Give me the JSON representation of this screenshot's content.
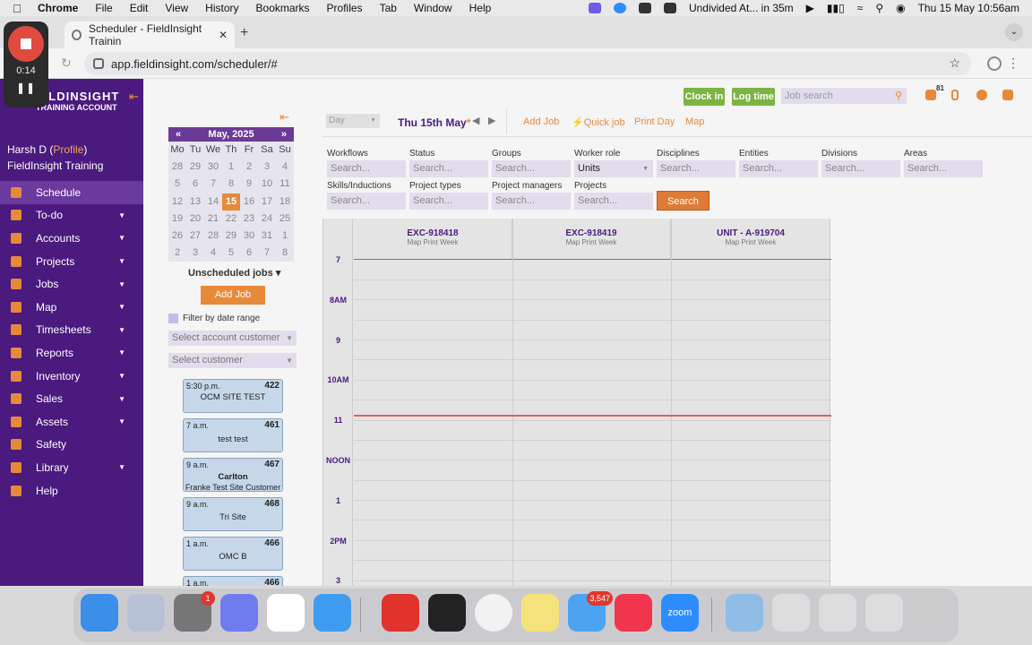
{
  "menubar": {
    "app": "Chrome",
    "items": [
      "File",
      "Edit",
      "View",
      "History",
      "Bookmarks",
      "Profiles",
      "Tab",
      "Window",
      "Help"
    ],
    "meeting": "Undivided At... in 35m",
    "datetime": "Thu 15 May  10:56am"
  },
  "browser": {
    "tab_title": "Scheduler - FieldInsight Trainin",
    "url": "app.fieldinsight.com/scheduler/#"
  },
  "recorder": {
    "time": "0:14"
  },
  "brand": {
    "name": "FIELDINSIGHT",
    "name_visible": "IELDINSIGHT",
    "account": "TRAINING ACCOUNT"
  },
  "user": {
    "name": "Harsh D",
    "profile_link": "Profile",
    "org": "FieldInsight Training"
  },
  "nav": [
    {
      "label": "Schedule",
      "arrow": false,
      "active": true
    },
    {
      "label": "To-do",
      "arrow": true
    },
    {
      "label": "Accounts",
      "arrow": true
    },
    {
      "label": "Projects",
      "arrow": true
    },
    {
      "label": "Jobs",
      "arrow": true
    },
    {
      "label": "Map",
      "arrow": true
    },
    {
      "label": "Timesheets",
      "arrow": true
    },
    {
      "label": "Reports",
      "arrow": true
    },
    {
      "label": "Inventory",
      "arrow": true
    },
    {
      "label": "Sales",
      "arrow": true
    },
    {
      "label": "Assets",
      "arrow": true
    },
    {
      "label": "Safety",
      "arrow": false
    },
    {
      "label": "Library",
      "arrow": true
    },
    {
      "label": "Help",
      "arrow": false
    }
  ],
  "calendar": {
    "prev": "«",
    "next": "»",
    "title": "May, 2025",
    "weekdays": [
      "Mo",
      "Tu",
      "We",
      "Th",
      "Fr",
      "Sa",
      "Su"
    ],
    "weeks": [
      [
        "28",
        "29",
        "30",
        "1",
        "2",
        "3",
        "4"
      ],
      [
        "5",
        "6",
        "7",
        "8",
        "9",
        "10",
        "11"
      ],
      [
        "12",
        "13",
        "14",
        "15",
        "16",
        "17",
        "18"
      ],
      [
        "19",
        "20",
        "21",
        "22",
        "23",
        "24",
        "25"
      ],
      [
        "26",
        "27",
        "28",
        "29",
        "30",
        "31",
        "1"
      ],
      [
        "2",
        "3",
        "4",
        "5",
        "6",
        "7",
        "8"
      ]
    ],
    "today": "15"
  },
  "left": {
    "unscheduled": "Unscheduled jobs",
    "add_job": "Add Job",
    "filter_label": "Filter by date range",
    "account_placeholder": "Select account customer",
    "customer_placeholder": "Select customer"
  },
  "jobs": [
    {
      "time": "5:30 p.m.",
      "num": "422",
      "lines": [
        "OCM SITE TEST"
      ]
    },
    {
      "time": "7 a.m.",
      "num": "461",
      "lines": [
        "test test"
      ]
    },
    {
      "time": "9 a.m.",
      "num": "467",
      "lines": [
        "Carlton",
        "Franke Test Site Customer"
      ]
    },
    {
      "time": "9 a.m.",
      "num": "468",
      "lines": [
        "Tri Site"
      ]
    },
    {
      "time": "1 a.m.",
      "num": "466",
      "lines": [
        "OMC B"
      ]
    },
    {
      "time": "1 a.m.",
      "num": "466",
      "lines": [
        ""
      ]
    }
  ],
  "header": {
    "clock_in": "Clock in",
    "log_time": "Log time",
    "job_search_placeholder": "Job search",
    "notifications": "81"
  },
  "toolbar": {
    "view": "Day",
    "date": "Thu 15th May",
    "date_marker": "*",
    "prev": "◀",
    "next": "▶",
    "add_job": "Add Job",
    "quick_job": "Quick job",
    "print_day": "Print Day",
    "map": "Map"
  },
  "filters": {
    "row1": [
      {
        "label": "Workflows",
        "value": "Search..."
      },
      {
        "label": "Status",
        "value": "Search..."
      },
      {
        "label": "Groups",
        "value": "Search..."
      },
      {
        "label": "Worker role",
        "value": "Units"
      },
      {
        "label": "Disciplines",
        "value": "Search..."
      },
      {
        "label": "Entities",
        "value": "Search..."
      },
      {
        "label": "Divisions",
        "value": "Search..."
      },
      {
        "label": "Areas",
        "value": "Search..."
      }
    ],
    "row2": [
      {
        "label": "Skills/Inductions",
        "value": "Search..."
      },
      {
        "label": "Project types",
        "value": "Search..."
      },
      {
        "label": "Project managers",
        "value": "Search..."
      },
      {
        "label": "Projects",
        "value": "Search..."
      }
    ],
    "search_button": "Search"
  },
  "schedule": {
    "columns": [
      {
        "title": "EXC-918418",
        "sub": "Map Print Week"
      },
      {
        "title": "EXC-918419",
        "sub": "Map Print Week"
      },
      {
        "title": "UNIT - A-919704",
        "sub": "Map Print Week"
      }
    ],
    "times": [
      "7",
      "8AM",
      "9",
      "10AM",
      "11",
      "NOON",
      "1",
      "2PM",
      "3"
    ]
  },
  "dock": {
    "settings_badge": "1",
    "mail_badge": "3,547",
    "zoom_label": "zoom"
  },
  "colors": {
    "sidebar": "#4a1a7f",
    "accent": "#e68a3a",
    "green": "#7cb342",
    "now_line": "#e35d6a"
  }
}
